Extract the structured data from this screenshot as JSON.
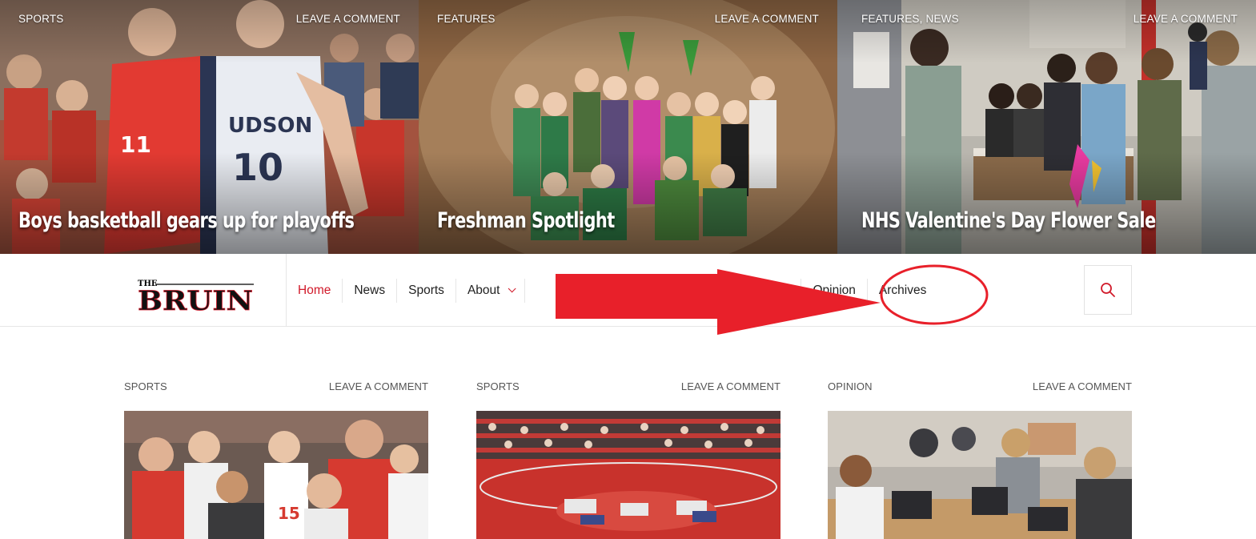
{
  "hero": {
    "slides": [
      {
        "category": "SPORTS",
        "comment_link": "LEAVE A COMMENT",
        "title": "Boys basketball gears up for playoffs",
        "image": "basketball-players-photo"
      },
      {
        "category": "FEATURES",
        "comment_link": "LEAVE A COMMENT",
        "title": "Freshman Spotlight",
        "image": "student-group-costume-photo"
      },
      {
        "category": "FEATURES, NEWS",
        "comment_link": "LEAVE A COMMENT",
        "title": "NHS Valentine's Day Flower Sale",
        "image": "students-at-sale-table-photo"
      }
    ]
  },
  "site": {
    "logo_top": "THE",
    "logo_main": "BRUIN"
  },
  "nav": {
    "items": [
      {
        "label": "Home",
        "active": true
      },
      {
        "label": "News"
      },
      {
        "label": "Sports"
      },
      {
        "label": "About",
        "has_dropdown": true
      },
      {
        "label": "Opinion"
      },
      {
        "label": "Archives"
      }
    ],
    "search_icon": "search-icon"
  },
  "posts": [
    {
      "category": "SPORTS",
      "comment_link": "LEAVE A COMMENT",
      "image": "basketball-team-huddle-photo"
    },
    {
      "category": "SPORTS",
      "comment_link": "LEAVE A COMMENT",
      "image": "wrestling-team-on-mat-photo"
    },
    {
      "category": "OPINION",
      "comment_link": "LEAVE A COMMENT",
      "image": "students-at-laptops-photo"
    }
  ],
  "colors": {
    "accent": "#d11a2a",
    "annotation_red": "#e8202a",
    "text_dark": "#222222",
    "text_meta": "#555555"
  }
}
